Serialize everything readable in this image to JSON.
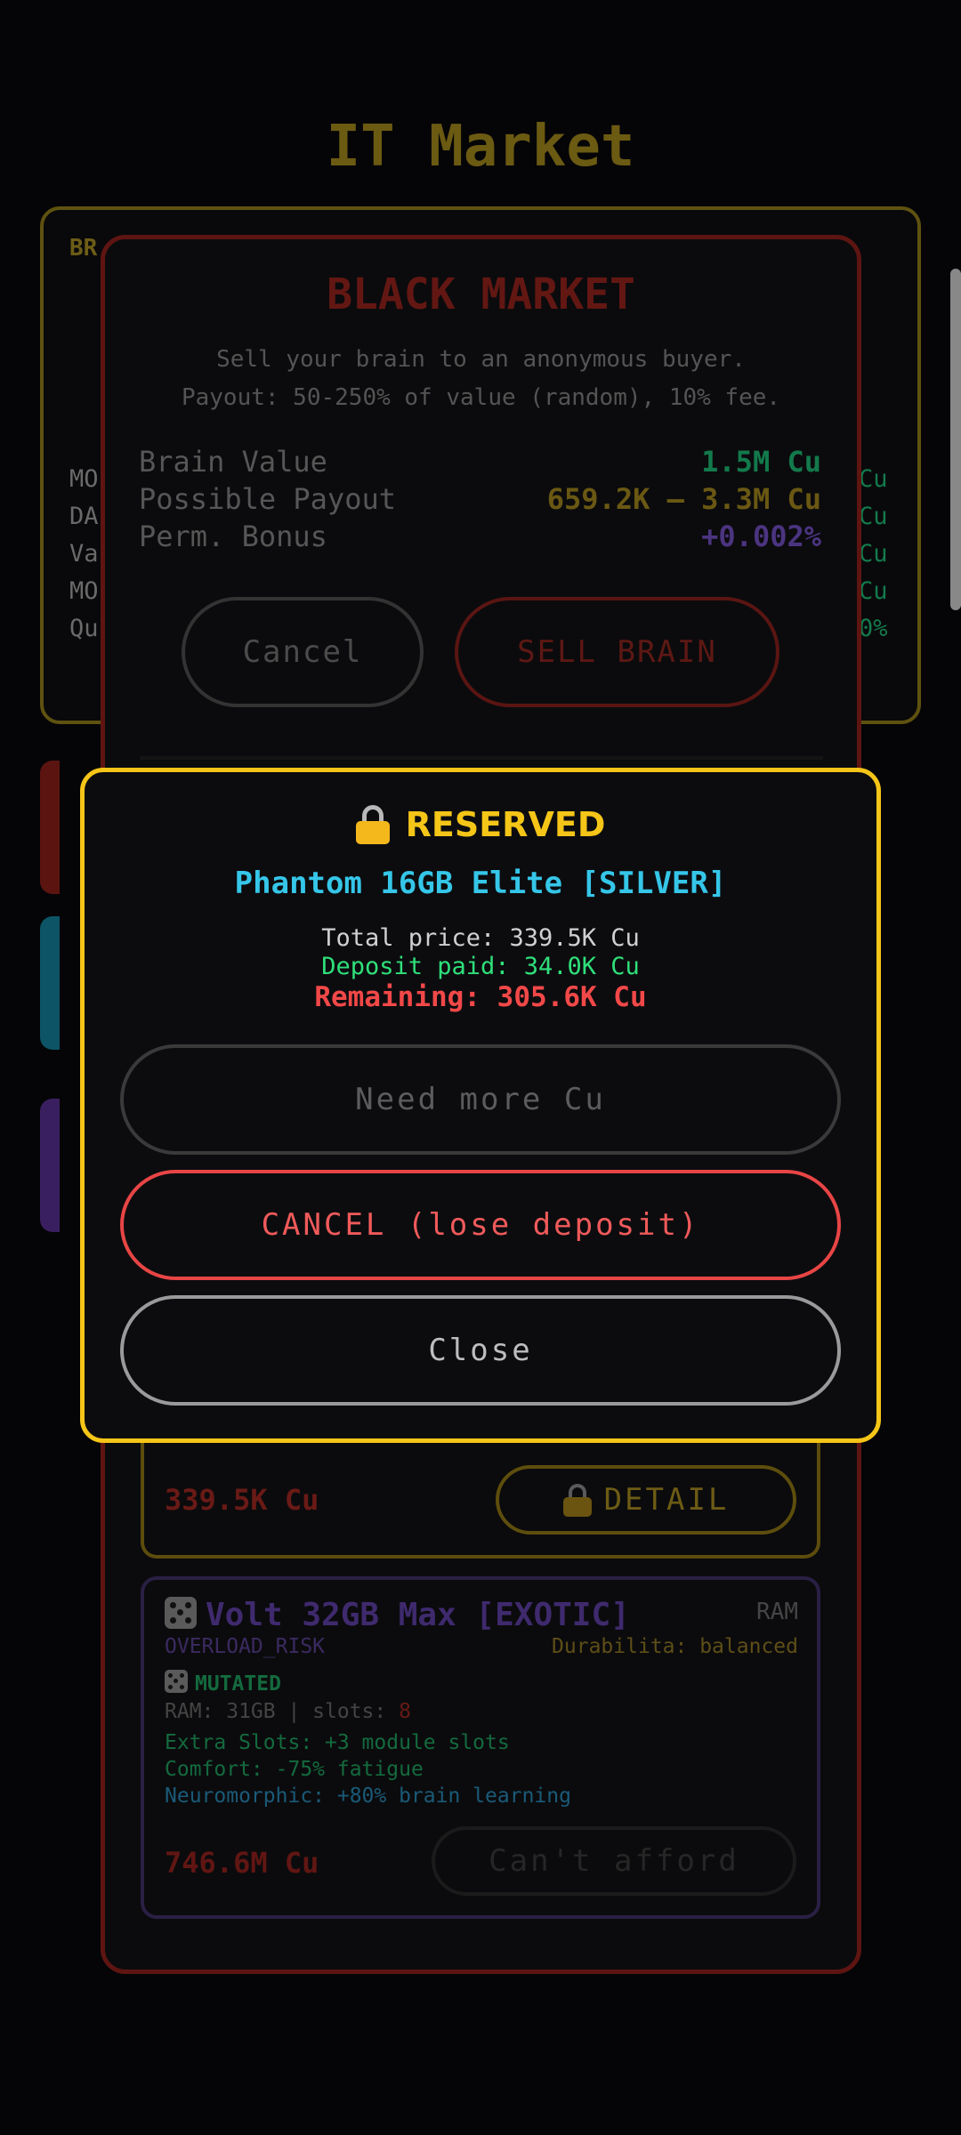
{
  "background": {
    "title": "IT Market",
    "panel_title": "BR",
    "rows": [
      {
        "label": "MO",
        "value": "Cu"
      },
      {
        "label": "DA",
        "value": "Cu"
      },
      {
        "label": "Va",
        "value": "Cu"
      },
      {
        "label": "MO",
        "value": "Cu"
      },
      {
        "label": "Qu",
        "value": "0%"
      }
    ]
  },
  "black_market": {
    "title": "BLACK MARKET",
    "desc1": "Sell your brain to an anonymous buyer.",
    "desc2": "Payout: 50-250% of value (random), 10% fee.",
    "rows": [
      {
        "label": "Brain Value",
        "value": "1.5M Cu",
        "color": "#137a4c"
      },
      {
        "label": "Possible Payout",
        "value": "659.2K – 3.3M Cu",
        "color": "#6a5813"
      },
      {
        "label": "Perm. Bonus",
        "value": "+0.002%",
        "color": "#4b3480"
      }
    ],
    "cancel_label": "Cancel",
    "sell_label": "SELL BRAIN"
  },
  "listing1": {
    "price": "339.5K Cu",
    "button_label": "DETAIL"
  },
  "listing2": {
    "title": "Volt 32GB Max [EXOTIC]",
    "type": "RAM",
    "tag": "OVERLOAD_RISK",
    "durability": "Durabilita: balanced",
    "mutated": "MUTATED",
    "ram_text": "RAM: 31GB | slots: ",
    "slots": "8",
    "effects": [
      {
        "text": "Extra Slots: +3 module slots",
        "color": "#146a3e"
      },
      {
        "text": "Comfort: -75% fatigue",
        "color": "#146a3e"
      },
      {
        "text": "Neuromorphic: +80% brain learning",
        "color": "#1a5a78"
      }
    ],
    "price": "746.6M Cu",
    "button_label": "Can't afford"
  },
  "reserved": {
    "title": "RESERVED",
    "item": "Phantom 16GB Elite [SILVER]",
    "total": "Total price: 339.5K Cu",
    "deposit": "Deposit paid: 34.0K Cu",
    "remaining": "Remaining: 305.6K Cu",
    "need_label": "Need more Cu",
    "cancel_label": "CANCEL (lose deposit)",
    "close_label": "Close",
    "colors": {
      "accent": "#f5c518",
      "item": "#35c6e8",
      "deposit": "#2fe07a",
      "remaining": "#f24848"
    }
  }
}
